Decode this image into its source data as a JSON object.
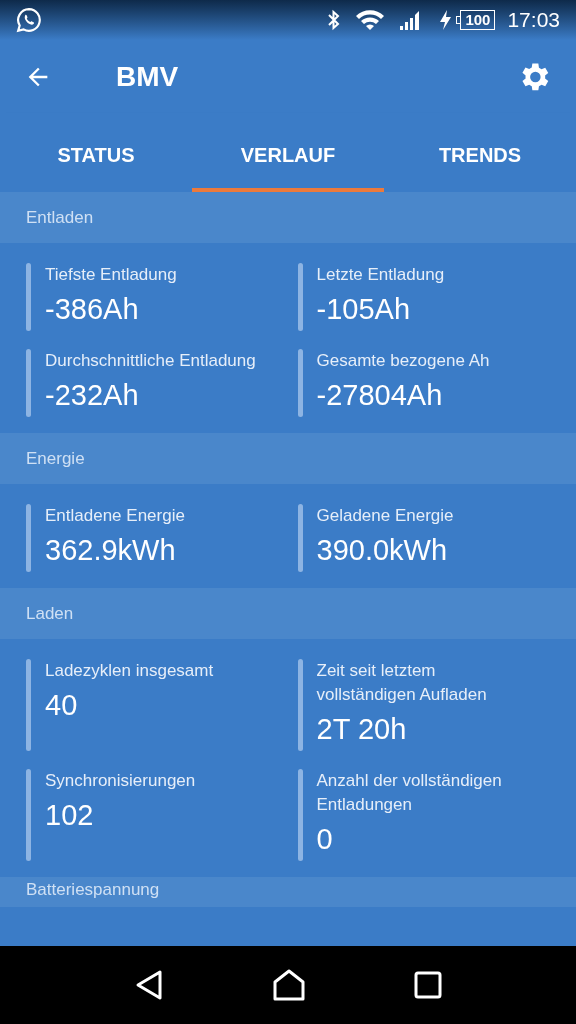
{
  "status_bar": {
    "battery": "100",
    "time": "17:03"
  },
  "app_bar": {
    "title": "BMV"
  },
  "tabs": [
    {
      "label": "STATUS",
      "selected": false
    },
    {
      "label": "VERLAUF",
      "selected": true
    },
    {
      "label": "TRENDS",
      "selected": false
    }
  ],
  "sections": [
    {
      "title": "Entladen",
      "items": [
        {
          "label": "Tiefste Entladung",
          "value": "-386Ah"
        },
        {
          "label": "Letzte Entladung",
          "value": "-105Ah"
        },
        {
          "label": "Durchschnittliche Entladung",
          "value": "-232Ah"
        },
        {
          "label": "Gesamte bezogene Ah",
          "value": "-27804Ah"
        }
      ]
    },
    {
      "title": "Energie",
      "items": [
        {
          "label": "Entladene Energie",
          "value": "362.9kWh"
        },
        {
          "label": "Geladene Energie",
          "value": "390.0kWh"
        }
      ]
    },
    {
      "title": "Laden",
      "items": [
        {
          "label": "Ladezyklen insgesamt",
          "value": "40"
        },
        {
          "label": "Zeit seit letztem vollständigen Aufladen",
          "value": "2T 20h"
        },
        {
          "label": "Synchronisierungen",
          "value": "102"
        },
        {
          "label": "Anzahl der vollständigen Entladungen",
          "value": "0"
        }
      ]
    },
    {
      "title": "Batteriespannung"
    }
  ]
}
